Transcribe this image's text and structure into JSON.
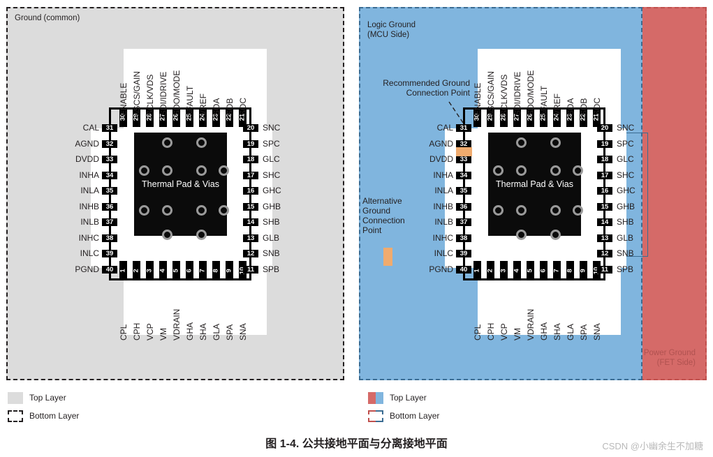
{
  "figure": {
    "caption": "图 1-4. 公共接地平面与分离接地平面",
    "watermark": "CSDN @小幽余生不加糖"
  },
  "left_panel": {
    "plane_label": "Ground (common)",
    "legend": [
      {
        "label": "Top Layer",
        "swatch": "solid-grey",
        "color": "#dcdcdc"
      },
      {
        "label": "Bottom Layer",
        "swatch": "dashed-grey",
        "color": "#231f20"
      }
    ]
  },
  "right_panel": {
    "logic_ground_label": "Logic Ground\n(MCU Side)",
    "logic_ground_line1": "Logic Ground",
    "logic_ground_line2": "(MCU Side)",
    "power_ground_line1": "Power Ground",
    "power_ground_line2": "(FET Side)",
    "recommended_label_line1": "Recommended Ground",
    "recommended_label_line2": "Connection Point",
    "alternative_label": "Alternative\nGround\nConnection\nPoint",
    "alternative_line1": "Alternative",
    "alternative_line2": "Ground",
    "alternative_line3": "Connection",
    "alternative_line4": "Point",
    "legend": [
      {
        "label": "Top Layer",
        "swatch": "split-red-blue",
        "colors": [
          "#d56a68",
          "#80b5de"
        ]
      },
      {
        "label": "Bottom Layer",
        "swatch": "dashed-split",
        "colors": [
          "#c0504d",
          "#3b6c92"
        ]
      }
    ]
  },
  "colors": {
    "logic_ground_blue": "#80b5de",
    "power_ground_red": "#d56a68",
    "common_ground_grey": "#dcdcdc",
    "bridge_orange": "#f0ab6e",
    "thermal_pad": "#0b0b0b",
    "via_ring": "#9a9a9a"
  },
  "package": {
    "thermal_pad_label": "Thermal Pad & Vias",
    "via_count": 12,
    "pins_top": [
      {
        "num": "30",
        "label": "ENABLE"
      },
      {
        "num": "29",
        "label": "nSCS/GAIN"
      },
      {
        "num": "28",
        "label": "SCLK/VDS"
      },
      {
        "num": "27",
        "label": "SDI/IDRIVE"
      },
      {
        "num": "26",
        "label": "SDO/MODE"
      },
      {
        "num": "25",
        "label": "nFAULT"
      },
      {
        "num": "24",
        "label": "VREF"
      },
      {
        "num": "23",
        "label": "SOA"
      },
      {
        "num": "22",
        "label": "SOB"
      },
      {
        "num": "21",
        "label": "SOC"
      }
    ],
    "pins_left": [
      {
        "num": "31",
        "label": "CAL"
      },
      {
        "num": "32",
        "label": "AGND"
      },
      {
        "num": "33",
        "label": "DVDD"
      },
      {
        "num": "34",
        "label": "INHA"
      },
      {
        "num": "35",
        "label": "INLA"
      },
      {
        "num": "36",
        "label": "INHB"
      },
      {
        "num": "37",
        "label": "INLB"
      },
      {
        "num": "38",
        "label": "INHC"
      },
      {
        "num": "39",
        "label": "INLC"
      },
      {
        "num": "40",
        "label": "PGND"
      }
    ],
    "pins_right": [
      {
        "num": "20",
        "label": "SNC"
      },
      {
        "num": "19",
        "label": "SPC"
      },
      {
        "num": "18",
        "label": "GLC"
      },
      {
        "num": "17",
        "label": "SHC"
      },
      {
        "num": "16",
        "label": "GHC"
      },
      {
        "num": "15",
        "label": "GHB"
      },
      {
        "num": "14",
        "label": "SHB"
      },
      {
        "num": "13",
        "label": "GLB"
      },
      {
        "num": "12",
        "label": "SNB"
      },
      {
        "num": "11",
        "label": "SPB"
      }
    ],
    "pins_bottom": [
      {
        "num": "1",
        "label": "CPL"
      },
      {
        "num": "2",
        "label": "CPH"
      },
      {
        "num": "3",
        "label": "VCP"
      },
      {
        "num": "4",
        "label": "VM"
      },
      {
        "num": "5",
        "label": "VDRAIN"
      },
      {
        "num": "6",
        "label": "GHA"
      },
      {
        "num": "7",
        "label": "SHA"
      },
      {
        "num": "8",
        "label": "GLA"
      },
      {
        "num": "9",
        "label": "SPA"
      },
      {
        "num": "10",
        "label": "SNA"
      }
    ]
  }
}
